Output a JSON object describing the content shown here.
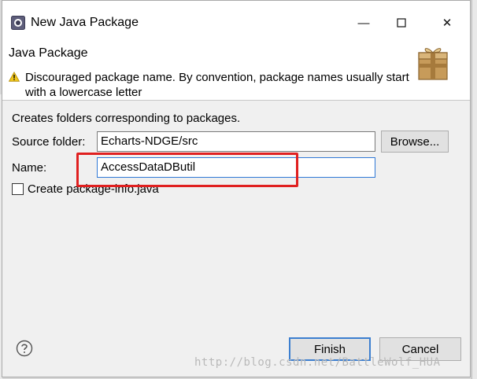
{
  "window": {
    "title": "New Java Package",
    "minimize_symbol": "—",
    "close_symbol": "✕"
  },
  "banner": {
    "title": "Java Package",
    "warning_text": "Discouraged package name. By convention, package names usually start with a lowercase letter",
    "warning_icon": "warning-icon",
    "image_icon": "package-icon"
  },
  "form": {
    "description": "Creates folders corresponding to packages.",
    "source_folder_label": "Source folder:",
    "source_folder_value": "Echarts-NDGE/src",
    "browse_label": "Browse...",
    "name_label": "Name:",
    "name_value": "AccessDataDButil",
    "create_package_info_label": "Create package-info.java",
    "create_package_info_checked": false
  },
  "footer": {
    "finish_label": "Finish",
    "cancel_label": "Cancel",
    "help_icon": "help-icon"
  },
  "watermark": "http://blog.csdn.net/BattleWolf_HUA",
  "colors": {
    "highlight": "#e02020",
    "focus": "#2f78d6"
  }
}
